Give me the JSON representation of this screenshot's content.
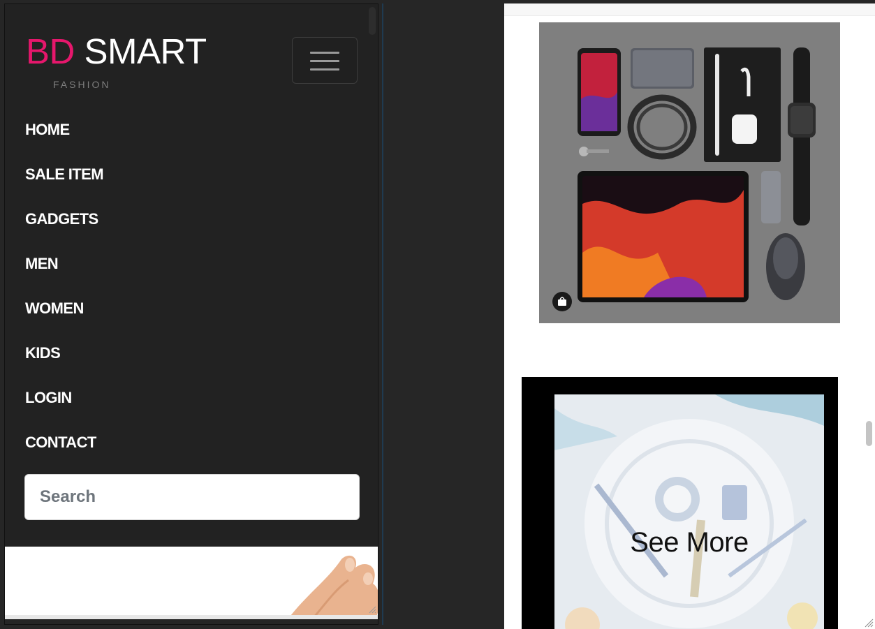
{
  "brand": {
    "part1": "BD",
    "part2": " SMART",
    "subtitle": "FASHION",
    "accent_color": "#e6176c"
  },
  "menu_toggle": {
    "icon": "hamburger-icon"
  },
  "nav": {
    "items": [
      {
        "label": "HOME"
      },
      {
        "label": "SALE ITEM"
      },
      {
        "label": "GADGETS"
      },
      {
        "label": "MEN"
      },
      {
        "label": "WOMEN"
      },
      {
        "label": "KIDS"
      },
      {
        "label": "LOGIN"
      },
      {
        "label": "CONTACT"
      }
    ]
  },
  "search": {
    "placeholder": "Search"
  },
  "right_panel": {
    "see_more_label": "See More",
    "bag_icon": "shopping-bag-icon"
  }
}
